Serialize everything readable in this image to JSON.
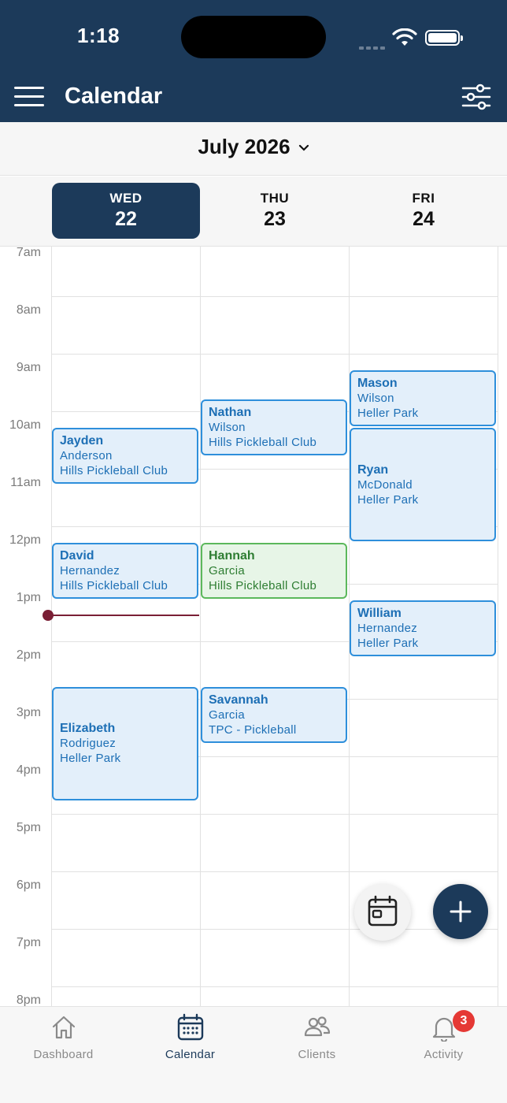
{
  "status": {
    "time": "1:18"
  },
  "header": {
    "title": "Calendar"
  },
  "month": {
    "label": "July 2026"
  },
  "days": [
    {
      "name": "WED",
      "num": "22",
      "selected": true
    },
    {
      "name": "THU",
      "num": "23",
      "selected": false
    },
    {
      "name": "FRI",
      "num": "24",
      "selected": false
    }
  ],
  "hours": [
    "7am",
    "8am",
    "9am",
    "10am",
    "11am",
    "12pm",
    "1pm",
    "2pm",
    "3pm",
    "4pm",
    "5pm",
    "6pm",
    "7pm",
    "8pm"
  ],
  "current_time": "1:18",
  "events": [
    {
      "day": "WED",
      "start": "10:00",
      "end": "11:00",
      "first": "Jayden",
      "last": "Anderson",
      "location": "Hills Pickleball Club",
      "status": "blue"
    },
    {
      "day": "WED",
      "start": "12:00",
      "end": "13:00",
      "first": "David",
      "last": "Hernandez",
      "location": "Hills Pickleball Club",
      "status": "blue"
    },
    {
      "day": "WED",
      "start": "14:30",
      "end": "16:30",
      "first": "Elizabeth",
      "last": "Rodriguez",
      "location": "Heller Park",
      "status": "blue"
    },
    {
      "day": "THU",
      "start": "09:30",
      "end": "10:30",
      "first": "Nathan",
      "last": "Wilson",
      "location": "Hills Pickleball Club",
      "status": "blue"
    },
    {
      "day": "THU",
      "start": "12:00",
      "end": "13:00",
      "first": "Hannah",
      "last": "Garcia",
      "location": "Hills Pickleball Club",
      "status": "green"
    },
    {
      "day": "THU",
      "start": "14:30",
      "end": "15:30",
      "first": "Savannah",
      "last": "Garcia",
      "location": "TPC - Pickleball",
      "status": "blue"
    },
    {
      "day": "FRI",
      "start": "09:00",
      "end": "10:00",
      "first": "Mason",
      "last": "Wilson",
      "location": "Heller Park",
      "status": "blue"
    },
    {
      "day": "FRI",
      "start": "10:00",
      "end": "12:00",
      "first": "Ryan",
      "last": "McDonald",
      "location": "Heller Park",
      "status": "blue"
    },
    {
      "day": "FRI",
      "start": "13:00",
      "end": "14:00",
      "first": "William",
      "last": "Hernandez",
      "location": "Heller Park",
      "status": "blue"
    }
  ],
  "colors": {
    "primary": "#1c3a5a",
    "event_blue_border": "#2e8fdb",
    "event_blue_bg": "#e3effa",
    "event_green_border": "#5cb85c",
    "event_green_bg": "#e7f5e7",
    "now_line": "#7a1f35",
    "badge": "#e53935"
  },
  "tabs": [
    {
      "label": "Dashboard",
      "icon": "home-icon",
      "active": false
    },
    {
      "label": "Calendar",
      "icon": "calendar-icon",
      "active": true
    },
    {
      "label": "Clients",
      "icon": "users-icon",
      "active": false
    },
    {
      "label": "Activity",
      "icon": "bell-icon",
      "active": false,
      "badge": "3"
    }
  ]
}
